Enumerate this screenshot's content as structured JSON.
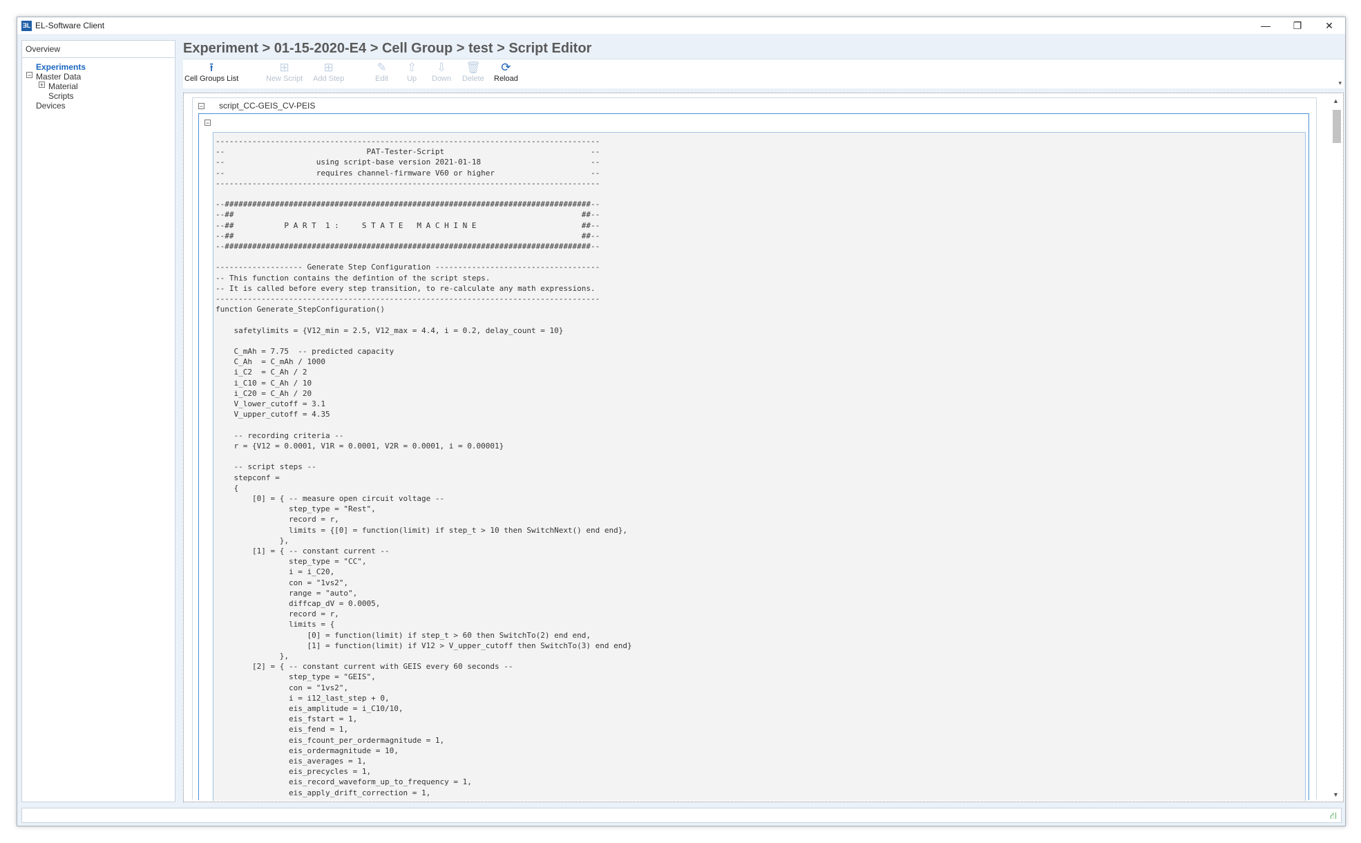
{
  "window": {
    "title": "EL-Software Client",
    "app_icon_text": "ƎL",
    "controls": {
      "minimize": "—",
      "restore": "❐",
      "close": "✕"
    }
  },
  "sidebar": {
    "header": "Overview",
    "items": [
      {
        "label": "Experiments",
        "active": true
      },
      {
        "label": "Master Data",
        "expander": "−"
      },
      {
        "label": "Material",
        "expander": "+"
      },
      {
        "label": "Scripts"
      },
      {
        "label": "Devices"
      }
    ]
  },
  "breadcrumb": "Experiment > 01-15-2020-E4 > Cell Group > test > Script Editor",
  "toolbar": {
    "buttons": [
      {
        "label": "Cell Groups List",
        "icon": "upload-arrow-icon",
        "glyph": "⭱",
        "enabled": true
      },
      {
        "label": "New Script",
        "icon": "new-script-icon",
        "glyph": "⊞",
        "enabled": false
      },
      {
        "label": "Add Step",
        "icon": "add-step-icon",
        "glyph": "⊞",
        "enabled": false
      },
      {
        "label": "Edit",
        "icon": "edit-icon",
        "glyph": "✎",
        "enabled": false
      },
      {
        "label": "Up",
        "icon": "up-arrow-icon",
        "glyph": "⇧",
        "enabled": false
      },
      {
        "label": "Down",
        "icon": "down-arrow-icon",
        "glyph": "⇩",
        "enabled": false
      },
      {
        "label": "Delete",
        "icon": "trash-icon",
        "glyph": "🗑",
        "enabled": false
      },
      {
        "label": "Reload",
        "icon": "reload-icon",
        "glyph": "⟳",
        "enabled": true
      }
    ]
  },
  "script": {
    "name": "script_CC-GEIS_CV-PEIS",
    "collapse_glyph": "−",
    "code_lines": [
      "------------------------------------------------------------------------------------",
      "--                               PAT-Tester-Script                                --",
      "--                    using script-base version 2021-01-18                        --",
      "--                    requires channel-firmware V60 or higher                     --",
      "------------------------------------------------------------------------------------",
      "",
      "--################################################################################--",
      "--##                                                                            ##--",
      "--##           P A R T  1 :     S T A T E   M A C H I N E                       ##--",
      "--##                                                                            ##--",
      "--################################################################################--",
      "",
      "------------------- Generate Step Configuration ------------------------------------",
      "-- This function contains the defintion of the script steps.",
      "-- It is called before every step transition, to re-calculate any math expressions.",
      "------------------------------------------------------------------------------------",
      "function Generate_StepConfiguration()",
      "",
      "    safetylimits = {V12_min = 2.5, V12_max = 4.4, i = 0.2, delay_count = 10}",
      "",
      "    C_mAh = 7.75  -- predicted capacity",
      "    C_Ah  = C_mAh / 1000",
      "    i_C2  = C_Ah / 2",
      "    i_C10 = C_Ah / 10",
      "    i_C20 = C_Ah / 20",
      "    V_lower_cutoff = 3.1",
      "    V_upper_cutoff = 4.35",
      "",
      "    -- recording criteria --",
      "    r = {V12 = 0.0001, V1R = 0.0001, V2R = 0.0001, i = 0.00001}",
      "",
      "    -- script steps --",
      "    stepconf =",
      "    {",
      "        [0] = { -- measure open circuit voltage --",
      "                step_type = \"Rest\",",
      "                record = r,",
      "                limits = {[0] = function(limit) if step_t > 10 then SwitchNext() end end},",
      "              },",
      "        [1] = { -- constant current --",
      "                step_type = \"CC\",",
      "                i = i_C20,",
      "                con = \"1vs2\",",
      "                range = \"auto\",",
      "                diffcap_dV = 0.0005,",
      "                record = r,",
      "                limits = {",
      "                    [0] = function(limit) if step_t > 60 then SwitchTo(2) end end,",
      "                    [1] = function(limit) if V12 > V_upper_cutoff then SwitchTo(3) end end}",
      "              },",
      "        [2] = { -- constant current with GEIS every 60 seconds --",
      "                step_type = \"GEIS\",",
      "                con = \"1vs2\",",
      "                i = i12_last_step + 0,",
      "                eis_amplitude = i_C10/10,",
      "                eis_fstart = 1,",
      "                eis_fend = 1,",
      "                eis_fcount_per_ordermagnitude = 1,",
      "                eis_ordermagnitude = 10,",
      "                eis_averages = 1,",
      "                eis_precycles = 1,",
      "                eis_record_waveform_up_to_frequency = 1,",
      "                eis_apply_drift_correction = 1,"
    ]
  },
  "colors": {
    "accent": "#1a66c2",
    "window_bg": "#eaf1f9",
    "code_bg": "#f3f3f3",
    "panel_border": "#4a90d9",
    "status_ok": "#2e9c3a"
  },
  "status": {
    "icon": "network-status-icon",
    "glyph": "⛙"
  }
}
